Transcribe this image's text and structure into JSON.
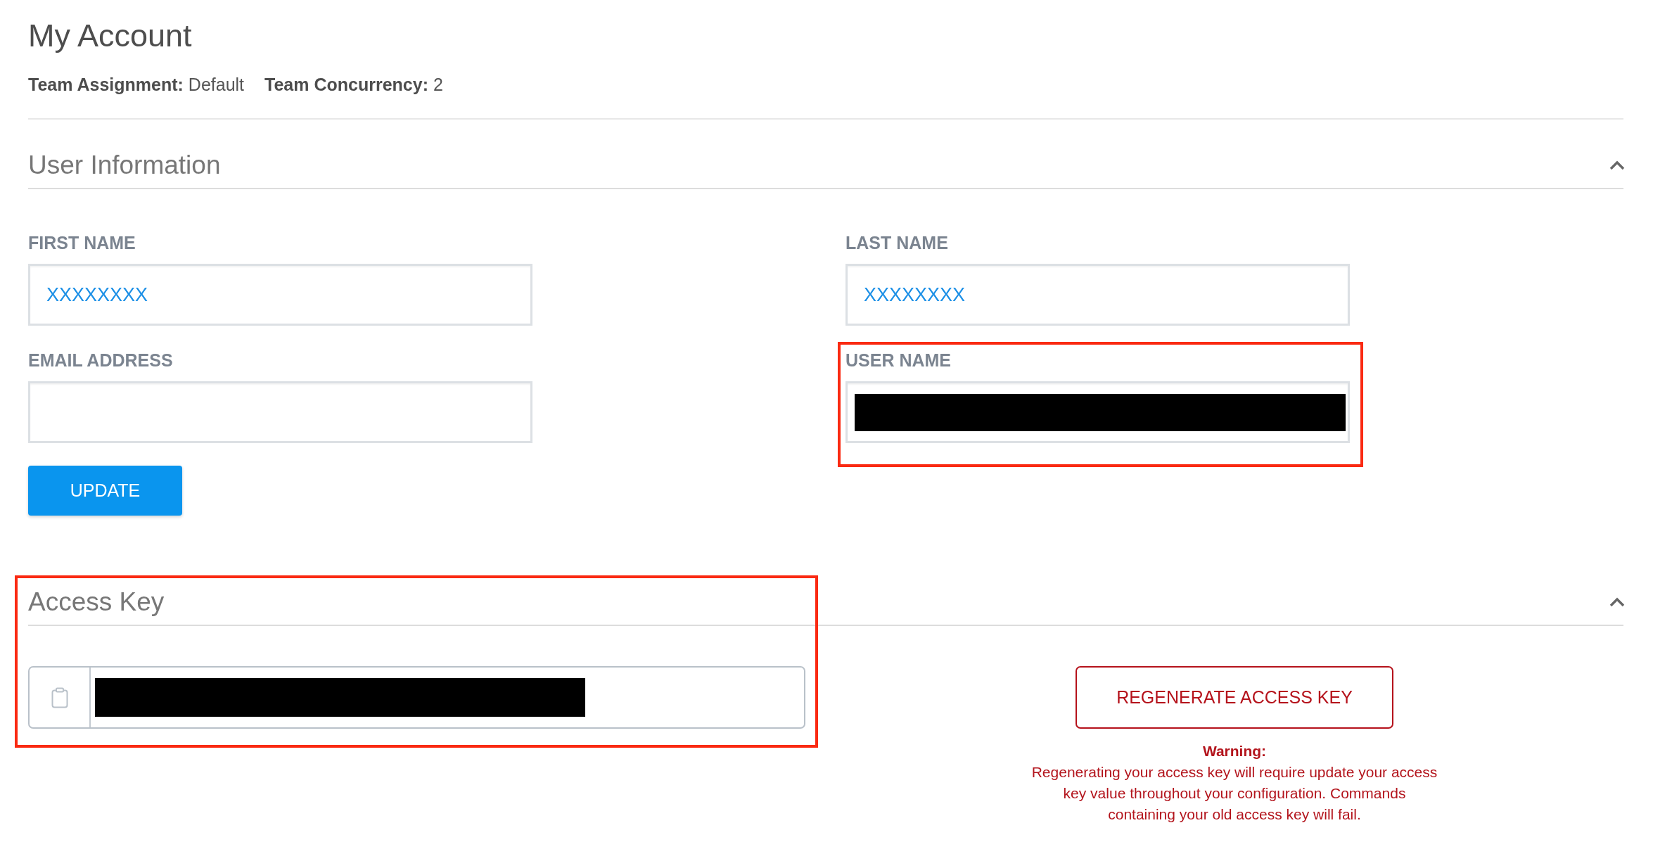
{
  "page": {
    "title": "My Account"
  },
  "summary": [
    "**Team Assignment:** Default",
    "**Team Concurrency:** 2"
  ],
  "sections": [
    {
      "kind": "form",
      "title": "User Information",
      "expanded": true,
      "highlighted": false,
      "fields": [
        {
          "label": "FIRST NAME",
          "value": "XXXXXXXX",
          "redacted": false,
          "highlighted": false
        },
        {
          "label": "LAST NAME",
          "value": "XXXXXXXX",
          "redacted": false,
          "highlighted": false
        },
        {
          "label": "EMAIL ADDRESS",
          "redacted": false,
          "highlighted": false
        },
        {
          "label": "USER NAME",
          "redacted": true,
          "highlighted": true
        }
      ],
      "button": "UPDATE"
    },
    {
      "kind": "access_key",
      "title": "Access Key",
      "expanded": true,
      "highlighted": true,
      "key_field": {
        "redacted": true
      },
      "button": "REGENERATE ACCESS KEY",
      "warning": {
        "title": "Warning:",
        "body": "Regenerating your access key will require update your access key value throughout your configuration. Commands containing your old access key will fail."
      }
    }
  ]
}
